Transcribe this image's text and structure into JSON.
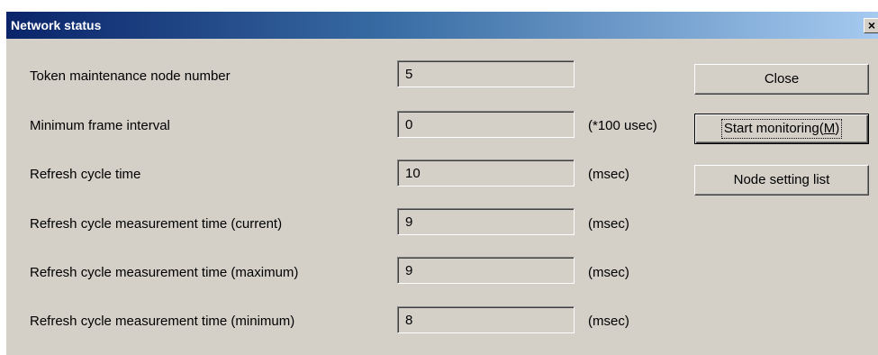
{
  "window": {
    "title": "Network status",
    "close_glyph": "×"
  },
  "rows": [
    {
      "label": "Token maintenance node number",
      "value": "5",
      "unit": ""
    },
    {
      "label": "Minimum frame interval",
      "value": "0",
      "unit": "(*100 usec)"
    },
    {
      "label": "Refresh cycle time",
      "value": "10",
      "unit": "(msec)"
    },
    {
      "label": "Refresh cycle measurement time (current)",
      "value": "9",
      "unit": "(msec)"
    },
    {
      "label": "Refresh cycle measurement time (maximum)",
      "value": "9",
      "unit": "(msec)"
    },
    {
      "label": "Refresh cycle measurement time (minimum)",
      "value": "8",
      "unit": "(msec)"
    }
  ],
  "buttons": {
    "close": "Close",
    "start_monitoring": "Start monitoring(",
    "start_monitoring_key": "M",
    "start_monitoring_end": ")",
    "node_setting_list": "Node setting list"
  },
  "colors": {
    "title_start": "#0a246a",
    "title_end": "#a6caf0",
    "face": "#d4d0c8"
  }
}
